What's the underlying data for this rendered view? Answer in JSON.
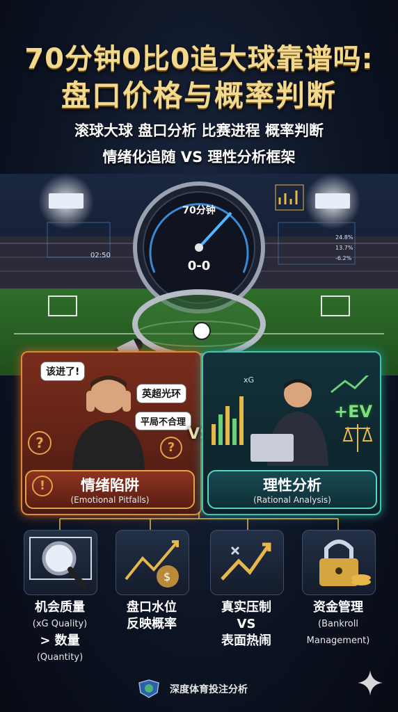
{
  "title_line1": "70分钟0比0追大球靠谱吗:",
  "title_line2": "盘口价格与概率判断",
  "subtitle_line1": "滚球大球 盘口分析 比赛进程 概率判断",
  "subtitle_line2": "情绪化追随 VS 理性分析框架",
  "gauge": {
    "minute_label": "70分钟",
    "score": "0-0"
  },
  "side_readouts": {
    "left_clock": "02:50",
    "right_values": [
      "24.8%",
      "13.7%",
      "-6.2%"
    ]
  },
  "left_panel": {
    "bubble_1": "该进了!",
    "bubble_2": "英超光环",
    "bubble_3": "平局不合理",
    "caption_main": "情绪陷阱",
    "caption_en": "(Emotional Pitfalls)"
  },
  "vs_label": "VS",
  "right_panel": {
    "xg_label": "xG",
    "ev_label": "+EV",
    "caption_main": "理性分析",
    "caption_en": "(Rational Analysis)"
  },
  "cards": [
    {
      "line1": "机会质量",
      "line2": "(xG Quality)",
      "line3": "> 数量",
      "line4": "(Quantity)",
      "icon": "magnifier-ball-icon"
    },
    {
      "line1": "盘口水位",
      "line2": "反映概率",
      "icon": "chart-moneybag-icon"
    },
    {
      "line1": "真实压制",
      "line2": "VS",
      "line3": "表面热闹",
      "icon": "zigzag-arrow-icon"
    },
    {
      "line1": "资金管理",
      "line2": "(Bankroll",
      "line3": "Management)",
      "icon": "padlock-coins-icon"
    }
  ],
  "footer": {
    "text": "深度体育投注分析"
  },
  "colors": {
    "gold": "#f3d98e",
    "emotional": "#e08a3c",
    "rational": "#43c4b2",
    "ev_green": "#7ee07a"
  }
}
